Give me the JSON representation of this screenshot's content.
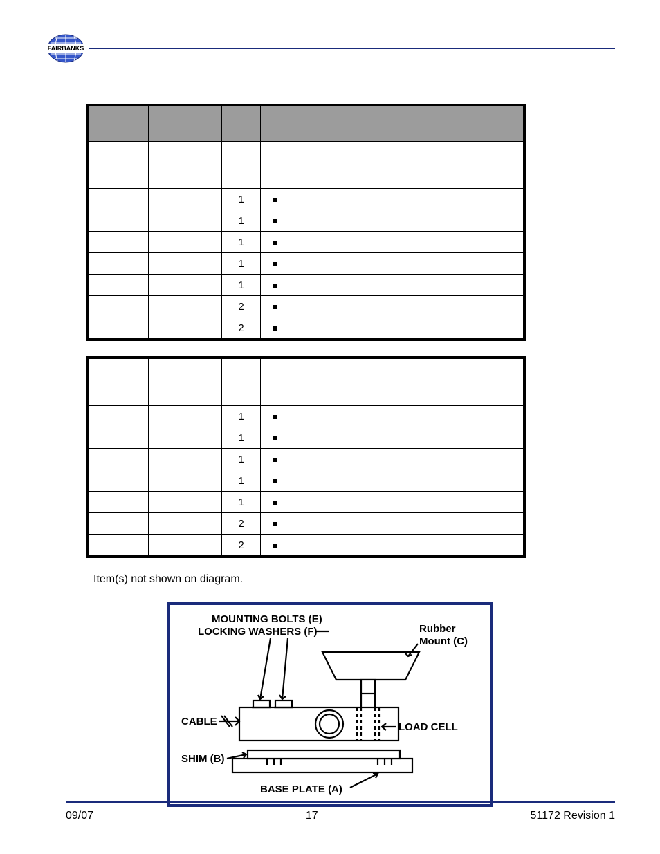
{
  "header": {
    "logo_text": "FAIRBANKS"
  },
  "tables": [
    {
      "rows": [
        {
          "item": "",
          "part": "",
          "qty": "",
          "desc": ""
        },
        {
          "item": "",
          "part": "",
          "qty": "",
          "desc": ""
        },
        {
          "item": "",
          "part": "",
          "qty": "1",
          "desc": ""
        },
        {
          "item": "",
          "part": "",
          "qty": "1",
          "desc": ""
        },
        {
          "item": "",
          "part": "",
          "qty": "1",
          "desc": ""
        },
        {
          "item": "",
          "part": "",
          "qty": "1",
          "desc": ""
        },
        {
          "item": "",
          "part": "",
          "qty": "1",
          "desc": ""
        },
        {
          "item": "",
          "part": "",
          "qty": "2",
          "desc": ""
        },
        {
          "item": "",
          "part": "",
          "qty": "2",
          "desc": ""
        }
      ]
    },
    {
      "rows": [
        {
          "item": "",
          "part": "",
          "qty": "",
          "desc": ""
        },
        {
          "item": "",
          "part": "",
          "qty": "1",
          "desc": ""
        },
        {
          "item": "",
          "part": "",
          "qty": "1",
          "desc": ""
        },
        {
          "item": "",
          "part": "",
          "qty": "1",
          "desc": ""
        },
        {
          "item": "",
          "part": "",
          "qty": "1",
          "desc": ""
        },
        {
          "item": "",
          "part": "",
          "qty": "1",
          "desc": ""
        },
        {
          "item": "",
          "part": "",
          "qty": "2",
          "desc": ""
        },
        {
          "item": "",
          "part": "",
          "qty": "2",
          "desc": ""
        }
      ]
    }
  ],
  "note": "Item(s) not shown on diagram.",
  "diagram": {
    "labels": {
      "top1": "MOUNTING BOLTS (E)",
      "top2": "LOCKING WASHERS (F)",
      "rubber": "Rubber",
      "mount": "Mount (C)",
      "cable": "CABLE",
      "loadcell": "LOAD  CELL",
      "shim": "SHIM (B)",
      "base": "BASE PLATE (A)"
    }
  },
  "footer": {
    "left": "09/07",
    "center": "17",
    "right": "51172   Revision 1"
  }
}
